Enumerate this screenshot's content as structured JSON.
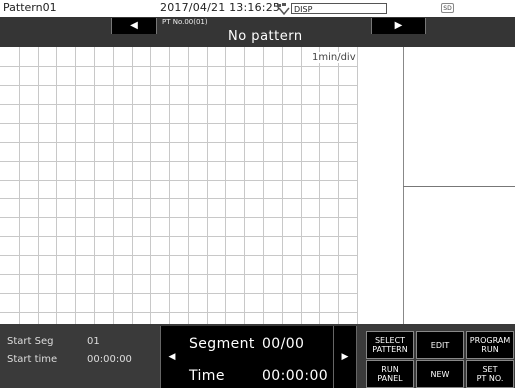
{
  "header": {
    "title": "Pattern01",
    "datetime": "2017/04/21 13:16:25",
    "disp_value": "DISP",
    "sd_label": "SD"
  },
  "pattern_nav": {
    "prev_label": "◀",
    "next_label": "▶",
    "pt_no": "PT No.00(01)",
    "pattern_name": "No pattern"
  },
  "chart": {
    "scale_label": "1min/div",
    "grid": true,
    "grid_color": "#c8c8c8"
  },
  "bottom": {
    "start_seg_label": "Start Seg",
    "start_seg_value": "01",
    "start_time_label": "Start time",
    "start_time_value": "00:00:00",
    "segment_label": "Segment",
    "segment_value": "00/00",
    "time_label": "Time",
    "time_value": "00:00:00",
    "prev_label": "◀",
    "next_label": "▶"
  },
  "functions": {
    "select_pattern": "SELECT\nPATTERN",
    "edit": "EDIT",
    "program_run": "PROGRAM\nRUN",
    "run_panel": "RUN\nPANEL",
    "new": "NEW",
    "set_pt_no": "SET\nPT NO."
  },
  "colors": {
    "nav_bar": "#353535",
    "bottom_panel": "#3a3a3a",
    "button_bg": "#000000"
  }
}
